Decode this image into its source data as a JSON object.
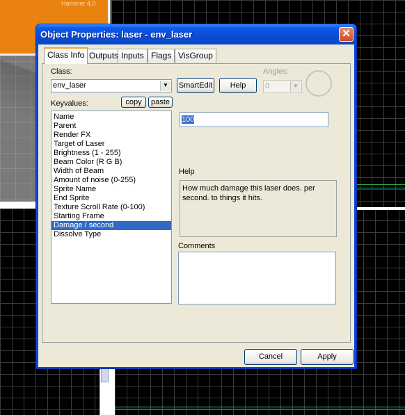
{
  "background": {
    "brand_text": "Hammer 4.0",
    "colors": {
      "orange": "#e9820e",
      "grid": "#3a3a3a",
      "cyan": "#19b8b8",
      "green": "#2ea52e"
    }
  },
  "dialog": {
    "title": "Object Properties: laser - env_laser",
    "close_icon": "close-x-icon",
    "tabs": [
      {
        "label": "Class Info",
        "active": true
      },
      {
        "label": "Outputs",
        "active": false
      },
      {
        "label": "Inputs",
        "active": false
      },
      {
        "label": "Flags",
        "active": false
      },
      {
        "label": "VisGroup",
        "active": false
      }
    ],
    "class_label": "Class:",
    "class_value": "env_laser",
    "smartedit_label": "SmartEdit",
    "help_button_label": "Help",
    "angles_label": "Angles:",
    "angles_value": "0",
    "keyvalues_label": "Keyvalues:",
    "copy_label": "copy",
    "paste_label": "paste",
    "keyvalues": [
      "Name",
      "Parent",
      "Render FX",
      "Target of Laser",
      "Brightness (1 - 255)",
      "Beam Color (R G B)",
      "Width of Beam",
      "Amount of noise (0-255)",
      "Sprite Name",
      "End Sprite",
      "Texture Scroll Rate (0-100)",
      "Starting Frame",
      "Damage / second",
      "Dissolve Type"
    ],
    "selected_keyvalue_index": 12,
    "value": "100",
    "help_section_label": "Help",
    "help_text": "How much damage this laser does. per second. to things it hits.",
    "comments_label": "Comments",
    "comments_text": "",
    "cancel_label": "Cancel",
    "apply_label": "Apply"
  }
}
